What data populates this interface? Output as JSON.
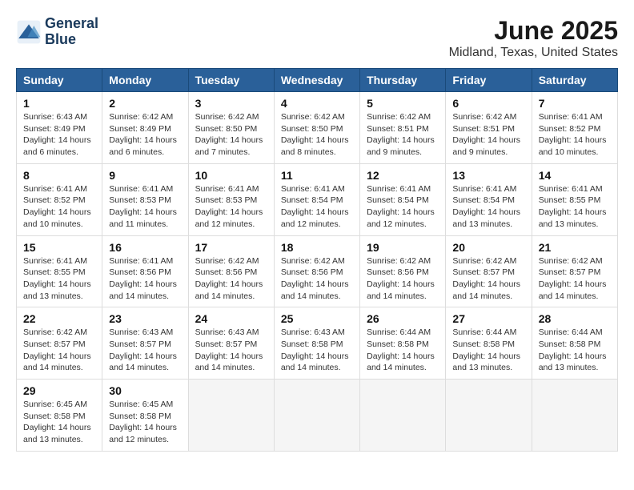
{
  "header": {
    "logo_line1": "General",
    "logo_line2": "Blue",
    "month_title": "June 2025",
    "location": "Midland, Texas, United States"
  },
  "days_of_week": [
    "Sunday",
    "Monday",
    "Tuesday",
    "Wednesday",
    "Thursday",
    "Friday",
    "Saturday"
  ],
  "weeks": [
    [
      {
        "day": "1",
        "sunrise": "6:43 AM",
        "sunset": "8:49 PM",
        "daylight": "14 hours and 6 minutes."
      },
      {
        "day": "2",
        "sunrise": "6:42 AM",
        "sunset": "8:49 PM",
        "daylight": "14 hours and 6 minutes."
      },
      {
        "day": "3",
        "sunrise": "6:42 AM",
        "sunset": "8:50 PM",
        "daylight": "14 hours and 7 minutes."
      },
      {
        "day": "4",
        "sunrise": "6:42 AM",
        "sunset": "8:50 PM",
        "daylight": "14 hours and 8 minutes."
      },
      {
        "day": "5",
        "sunrise": "6:42 AM",
        "sunset": "8:51 PM",
        "daylight": "14 hours and 9 minutes."
      },
      {
        "day": "6",
        "sunrise": "6:42 AM",
        "sunset": "8:51 PM",
        "daylight": "14 hours and 9 minutes."
      },
      {
        "day": "7",
        "sunrise": "6:41 AM",
        "sunset": "8:52 PM",
        "daylight": "14 hours and 10 minutes."
      }
    ],
    [
      {
        "day": "8",
        "sunrise": "6:41 AM",
        "sunset": "8:52 PM",
        "daylight": "14 hours and 10 minutes."
      },
      {
        "day": "9",
        "sunrise": "6:41 AM",
        "sunset": "8:53 PM",
        "daylight": "14 hours and 11 minutes."
      },
      {
        "day": "10",
        "sunrise": "6:41 AM",
        "sunset": "8:53 PM",
        "daylight": "14 hours and 12 minutes."
      },
      {
        "day": "11",
        "sunrise": "6:41 AM",
        "sunset": "8:54 PM",
        "daylight": "14 hours and 12 minutes."
      },
      {
        "day": "12",
        "sunrise": "6:41 AM",
        "sunset": "8:54 PM",
        "daylight": "14 hours and 12 minutes."
      },
      {
        "day": "13",
        "sunrise": "6:41 AM",
        "sunset": "8:54 PM",
        "daylight": "14 hours and 13 minutes."
      },
      {
        "day": "14",
        "sunrise": "6:41 AM",
        "sunset": "8:55 PM",
        "daylight": "14 hours and 13 minutes."
      }
    ],
    [
      {
        "day": "15",
        "sunrise": "6:41 AM",
        "sunset": "8:55 PM",
        "daylight": "14 hours and 13 minutes."
      },
      {
        "day": "16",
        "sunrise": "6:41 AM",
        "sunset": "8:56 PM",
        "daylight": "14 hours and 14 minutes."
      },
      {
        "day": "17",
        "sunrise": "6:42 AM",
        "sunset": "8:56 PM",
        "daylight": "14 hours and 14 minutes."
      },
      {
        "day": "18",
        "sunrise": "6:42 AM",
        "sunset": "8:56 PM",
        "daylight": "14 hours and 14 minutes."
      },
      {
        "day": "19",
        "sunrise": "6:42 AM",
        "sunset": "8:56 PM",
        "daylight": "14 hours and 14 minutes."
      },
      {
        "day": "20",
        "sunrise": "6:42 AM",
        "sunset": "8:57 PM",
        "daylight": "14 hours and 14 minutes."
      },
      {
        "day": "21",
        "sunrise": "6:42 AM",
        "sunset": "8:57 PM",
        "daylight": "14 hours and 14 minutes."
      }
    ],
    [
      {
        "day": "22",
        "sunrise": "6:42 AM",
        "sunset": "8:57 PM",
        "daylight": "14 hours and 14 minutes."
      },
      {
        "day": "23",
        "sunrise": "6:43 AM",
        "sunset": "8:57 PM",
        "daylight": "14 hours and 14 minutes."
      },
      {
        "day": "24",
        "sunrise": "6:43 AM",
        "sunset": "8:57 PM",
        "daylight": "14 hours and 14 minutes."
      },
      {
        "day": "25",
        "sunrise": "6:43 AM",
        "sunset": "8:58 PM",
        "daylight": "14 hours and 14 minutes."
      },
      {
        "day": "26",
        "sunrise": "6:44 AM",
        "sunset": "8:58 PM",
        "daylight": "14 hours and 14 minutes."
      },
      {
        "day": "27",
        "sunrise": "6:44 AM",
        "sunset": "8:58 PM",
        "daylight": "14 hours and 13 minutes."
      },
      {
        "day": "28",
        "sunrise": "6:44 AM",
        "sunset": "8:58 PM",
        "daylight": "14 hours and 13 minutes."
      }
    ],
    [
      {
        "day": "29",
        "sunrise": "6:45 AM",
        "sunset": "8:58 PM",
        "daylight": "14 hours and 13 minutes."
      },
      {
        "day": "30",
        "sunrise": "6:45 AM",
        "sunset": "8:58 PM",
        "daylight": "14 hours and 12 minutes."
      },
      null,
      null,
      null,
      null,
      null
    ]
  ]
}
